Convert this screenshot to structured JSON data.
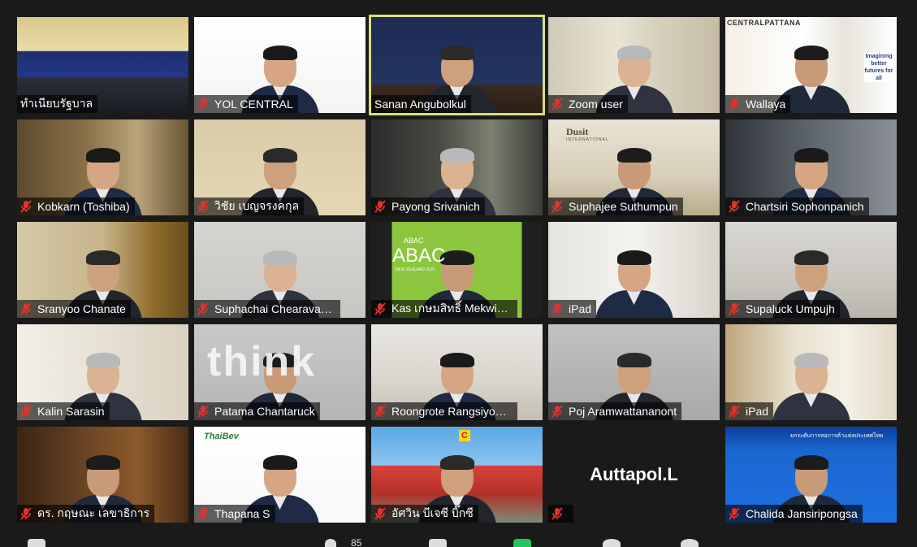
{
  "app": {
    "name": "Zoom"
  },
  "colors": {
    "background": "#1a1a1a",
    "active_speaker_border": "#d7e07a",
    "mute_red": "#e0322f",
    "name_tag_bg": "#000000"
  },
  "participants": [
    {
      "name": "ทำเนียบรัฐบาล",
      "muted": false,
      "scene": "conference-room"
    },
    {
      "name": "YOL CENTRAL",
      "muted": true,
      "scene": "white-wall-logo"
    },
    {
      "name": "Sanan Angubolkul",
      "muted": false,
      "active": true,
      "scene": "logos-podium"
    },
    {
      "name": "Zoom user",
      "muted": true,
      "scene": "office-shelves"
    },
    {
      "name": "Wallaya",
      "muted": true,
      "scene": "central-pattana-banner"
    },
    {
      "name": "Kobkarn (Toshiba)",
      "muted": true,
      "scene": "living-room"
    },
    {
      "name": "วิชัย เบญจรงคกุล",
      "muted": true,
      "scene": "beige-wall"
    },
    {
      "name": "Payong Srivanich",
      "muted": true,
      "scene": "office-window"
    },
    {
      "name": "Suphajee Suthumpun",
      "muted": true,
      "scene": "dusit-international-towers"
    },
    {
      "name": "Chartsiri Sophonpanich",
      "muted": true,
      "scene": "blurred-office"
    },
    {
      "name": "Sranyoo Chanate",
      "muted": true,
      "scene": "shelves-gold"
    },
    {
      "name": "Suphachai Chearavanont",
      "muted": true,
      "scene": "grey-wall"
    },
    {
      "name": "Kas เกษมสิทธิ์ Mekwichai",
      "muted": true,
      "scene": "abac-green-banner"
    },
    {
      "name": "iPad",
      "muted": true,
      "scene": "office-bright"
    },
    {
      "name": "Supaluck Umpujh",
      "muted": true,
      "scene": "carved-white-wall"
    },
    {
      "name": "Kalin Sarasin",
      "muted": true,
      "scene": "hotel-room"
    },
    {
      "name": "Patama Chantaruck",
      "muted": true,
      "scene": "think-wall"
    },
    {
      "name": "Roongrote Rangsiyopash",
      "muted": true,
      "scene": "office-ceiling"
    },
    {
      "name": "Poj Aramwattananont",
      "muted": true,
      "scene": "grey-room"
    },
    {
      "name": "iPad",
      "muted": true,
      "scene": "window-light"
    },
    {
      "name": "ดร. กฤษณะ เลขาธิการ",
      "muted": true,
      "scene": "wood-panel"
    },
    {
      "name": "Thapana S",
      "muted": true,
      "scene": "thaibev-white"
    },
    {
      "name": "อัศวิน บีเจซี บิ๊กซี",
      "muted": true,
      "scene": "bigc-building"
    },
    {
      "name": "",
      "display_name": "Auttapol.L",
      "muted": true,
      "scene": "camera-off"
    },
    {
      "name": "Chalida Jansiripongsa",
      "muted": true,
      "scene": "blue-banner"
    }
  ],
  "overlays": {
    "central_pattana": "CENTRALPATTANA",
    "imagining": "Imagining better futures for all",
    "dusit": "Dusit",
    "dusit_sub": "INTERNATIONAL",
    "abac": "ABAC",
    "abac_big": "ABAC",
    "abac_sub": "NEW ZEALAND 2021",
    "think": "think",
    "thaibev": "ThaiBev",
    "bigc": "C",
    "thai_gov_banner": "ยกระดับการหอการค้าแห่งประเทศไทย"
  },
  "toolbar": {
    "participants_count": "85"
  }
}
